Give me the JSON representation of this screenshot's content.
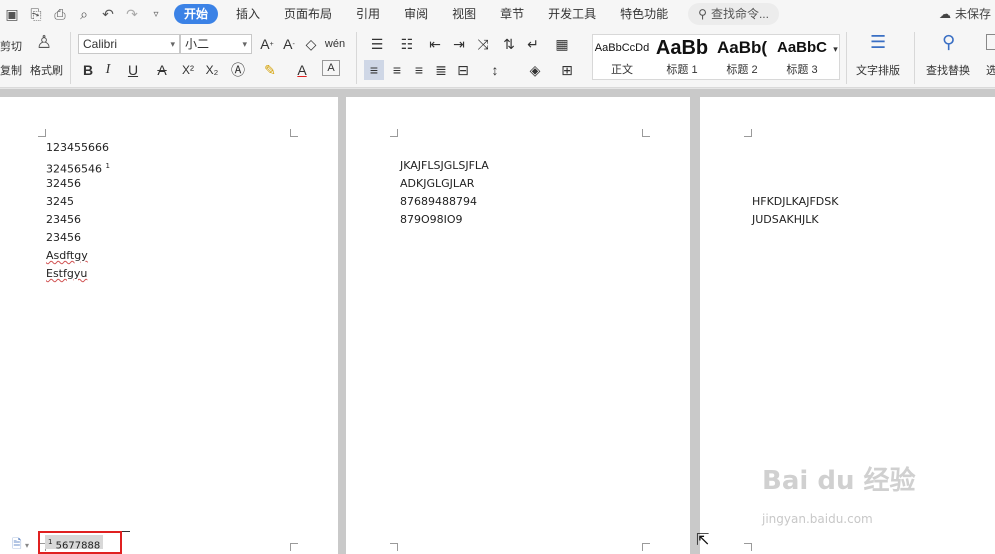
{
  "menubar": {
    "tabs": [
      "开始",
      "插入",
      "页面布局",
      "引用",
      "审阅",
      "视图",
      "章节",
      "开发工具",
      "特色功能"
    ],
    "search_label": "查找命令...",
    "unsaved_label": "未保存"
  },
  "ribbon": {
    "cut_label": "剪切",
    "copy_label": "复制",
    "format_painter_label": "格式刷",
    "font_name": "Calibri",
    "font_size": "小二",
    "styles": [
      {
        "sample": "AaBbCcDd",
        "name": "正文"
      },
      {
        "sample": "AaBb",
        "name": "标题 1"
      },
      {
        "sample": "AaBb(",
        "name": "标题 2"
      },
      {
        "sample": "AaBbC",
        "name": "标题 3"
      }
    ],
    "text_layout_label": "文字排版",
    "find_replace_label": "查找替换",
    "select_label": "选"
  },
  "pages": [
    {
      "lines": [
        "123455666",
        "32456546",
        "32456",
        "3245",
        "23456",
        "23456",
        "Asdftgy",
        "Estfgyu"
      ],
      "footnote_ref": "1",
      "footnote_mark": "1",
      "footnote_text": "5677888"
    },
    {
      "lines": [
        "JKAJFLSJGLSJFLA",
        "ADKJGLGJLAR",
        "87689488794",
        "879O98IO9"
      ]
    },
    {
      "lines": [
        "HFKDJLKAJFDSK",
        "JUDSAKHJLK"
      ]
    }
  ],
  "watermark": {
    "main": "Bai du 经验",
    "sub": "jingyan.baidu.com"
  }
}
